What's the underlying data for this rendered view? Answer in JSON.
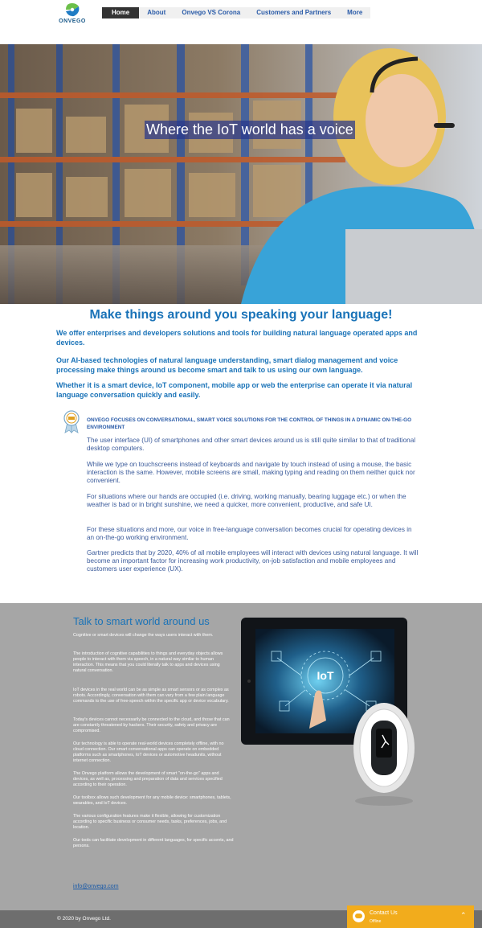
{
  "brand": {
    "name": "ONVEGO"
  },
  "nav": {
    "items": [
      {
        "label": "Home",
        "active": true
      },
      {
        "label": "About"
      },
      {
        "label": "Onvego VS Corona"
      },
      {
        "label": "Customers and Partners"
      },
      {
        "label": "More"
      }
    ]
  },
  "hero": {
    "title": "Where the IoT world has a voice"
  },
  "intro": {
    "headline": "Make things around you speaking your language!",
    "paragraphs": [
      "We offer enterprises and developers solutions and tools for  building natural language operated apps and devices.",
      "Our AI-based technologies of natural language understanding, smart dialog management and voice processing make things around us become smart and talk to us using our own language.",
      "Whether it is a smart device, IoT component, mobile app or web the enterprise can operate it via natural language conversation quickly and easily."
    ]
  },
  "focus": {
    "heading": "ONVEGO FOCUSES ON CONVERSATIONAL, SMART VOICE SOLUTIONS FOR THE CONTROL OF THINGS IN A DYNAMIC ON-THE-GO ENVIRONMENT",
    "paragraphs": [
      "The user interface (UI) of smartphones and other smart devices around us is still quite similar to that of traditional desktop computers.",
      "While we type on touchscreens instead of keyboards and navigate by touch instead of using a mouse, the basic interaction is the same. However, mobile screens are small, making typing and reading on them neither quick nor convenient.",
      "For situations where our hands are occupied (i.e. driving, working manually, bearing luggage etc.) or when the weather is bad or in bright sunshine, we need a quicker, more convenient, productive, and safe UI.",
      "For these situations and more, our voice in free-language conversation becomes crucial for operating devices in an on-the-go working environment.",
      "Gartner predicts that by 2020, 40% of all mobile employees will interact with devices using natural language. It will become an important factor for increasing work productivity, on-job satisfaction and mobile employees and customers user experience (UX)."
    ]
  },
  "talk": {
    "title": "Talk to smart world around us",
    "paragraphs": [
      "Cognitive or smart devices will change the ways users interact with them.",
      "The introduction of cognitive capabilities to things and everyday objects allows people to interact with them via speech, in a natural way similar to human interaction. This means that you could literally talk to apps and devices using natural conversation.",
      "IoT devices in the real world can be as simple as smart sensors or as complex as robots. Accordingly, conversation with them can vary from a few plain language commands to the use of free-speech within the specific app or device vocabulary.",
      "Today's devices cannot necessarily be connected to the cloud, and those that can are constantly threatened by hackers. Their security, safety and privacy are compromised.",
      "Our technology is able to operate real-world devices completely offline, with no cloud connection. Our smart conversational apps can operate on embedded platforms such as smartphones,  IoT devices or automotive headunits, without internet connection.",
      "The Onvego platform allows the development of smart \"on-the-go\" apps and devices, as well as, processing and preparation of data and services specified according to their operation.",
      "Our toolbox allows  such development for any mobile device: smartphones, tablets, wearables, and IoT devices.",
      "The various configuration features make it flexible, allowing for customization according to specific business or consumer needs, tasks, preferences, jobs, and location.",
      "Our tools can facilitate development in different languages, for specific accents, and persons."
    ],
    "email": "info@onvego.com",
    "tablet_label": "IoT"
  },
  "footer": {
    "copyright": "© 2020 by Onvego Ltd."
  },
  "chat": {
    "title": "Contact Us",
    "status": "Offline",
    "chevron": "⌃"
  },
  "colors": {
    "accent": "#1a73b8",
    "heading_blue": "#2a5ba8",
    "grey_band": "#a6a6a6",
    "chat_orange": "#f2ac1c",
    "footer": "#6e6e6e"
  }
}
